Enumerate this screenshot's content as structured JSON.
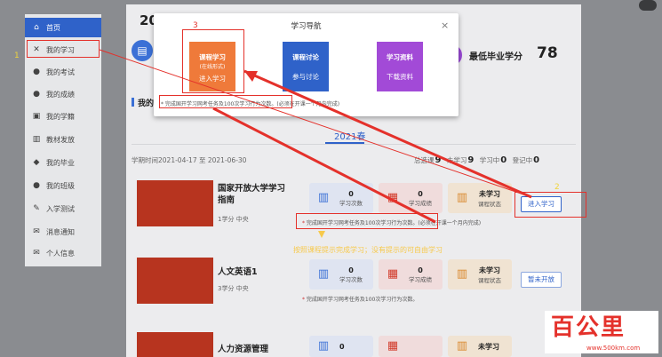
{
  "sidebar": {
    "items": [
      {
        "label": "首页",
        "icon": "home-icon",
        "glyph": "⌂",
        "active": true
      },
      {
        "label": "我的学习",
        "icon": "tools-icon",
        "glyph": "✕",
        "active": false
      },
      {
        "label": "我的考试",
        "icon": "pencil-icon",
        "glyph": "●",
        "active": false
      },
      {
        "label": "我的成绩",
        "icon": "chart-icon",
        "glyph": "●",
        "active": false
      },
      {
        "label": "我的学籍",
        "icon": "id-card-icon",
        "glyph": "▣",
        "active": false
      },
      {
        "label": "教材发放",
        "icon": "books-icon",
        "glyph": "▥",
        "active": false
      },
      {
        "label": "我的毕业",
        "icon": "graduation-cap-icon",
        "glyph": "◆",
        "active": false
      },
      {
        "label": "我的班级",
        "icon": "users-icon",
        "glyph": "●",
        "active": false
      },
      {
        "label": "入学测试",
        "icon": "edit-icon",
        "glyph": "✎",
        "active": false
      },
      {
        "label": "消息通知",
        "icon": "mail-icon",
        "glyph": "✉",
        "active": false
      },
      {
        "label": "个人信息",
        "icon": "envelope-icon",
        "glyph": "✉",
        "active": false
      }
    ]
  },
  "header": {
    "number_partial": "20",
    "min_credit_label": "最低毕业学分",
    "min_credit_value": "78"
  },
  "section": {
    "title_partial": "我的",
    "semester_tab": "2021春",
    "date_range": "学期时间2021-04-17 至 2021-06-30",
    "counts": [
      {
        "label": "总选课",
        "value": "9"
      },
      {
        "label": "未学习",
        "value": "9"
      },
      {
        "label": "学习中",
        "value": "0"
      },
      {
        "label": "登记中",
        "value": "0"
      }
    ]
  },
  "courses": [
    {
      "name_l1": "国家开放大学学习",
      "name_l2": "指南",
      "meta": "1学分 中央",
      "study_count": "0",
      "study_label": "学习次数",
      "score_value": "0",
      "score_label": "学习成绩",
      "status_value": "未学习",
      "status_label": "课程状态",
      "notice": "完成国开学习网考任务及100次学习行为次数。(必须在开课一个月内完成)",
      "action": "进入学习"
    },
    {
      "name_l1": "人文英语1",
      "name_l2": "",
      "meta": "3学分 中央",
      "study_count": "0",
      "study_label": "学习次数",
      "score_value": "0",
      "score_label": "学习成绩",
      "status_value": "未学习",
      "status_label": "课程状态",
      "notice": "完成国开学习网考任务及100次学习行为次数。",
      "action": "暂未开放"
    },
    {
      "name_l1": "人力资源管理",
      "name_l2": "",
      "meta": "",
      "study_count": "0",
      "study_label": "",
      "score_value": "",
      "score_label": "",
      "status_value": "未学习",
      "status_label": "",
      "notice": "",
      "action": ""
    }
  ],
  "modal": {
    "title": "学习导航",
    "close": "×",
    "buttons": [
      {
        "l1": "课程学习",
        "l2": "(在线形式)",
        "l3": "进入学习",
        "color": "#ef7a3a"
      },
      {
        "l1": "课程讨论",
        "l2": "",
        "l3": "参与讨论",
        "color": "#2f62c9"
      },
      {
        "l1": "学习资料",
        "l2": "",
        "l3": "下载资料",
        "color": "#a24ad7"
      }
    ],
    "note": "* 完成国开学习网考任务及100次学习行为次数。(必须在开课一个月内完成)"
  },
  "annotations": {
    "n1": "1",
    "n2": "2",
    "n3": "3",
    "hint": "按照课程提示完成学习；没有提示的可自由学习"
  },
  "watermark": {
    "logo": "百公里",
    "url": "www.500km.com"
  },
  "colors": {
    "accent": "#2f62c9",
    "highlight": "#e4312b"
  }
}
